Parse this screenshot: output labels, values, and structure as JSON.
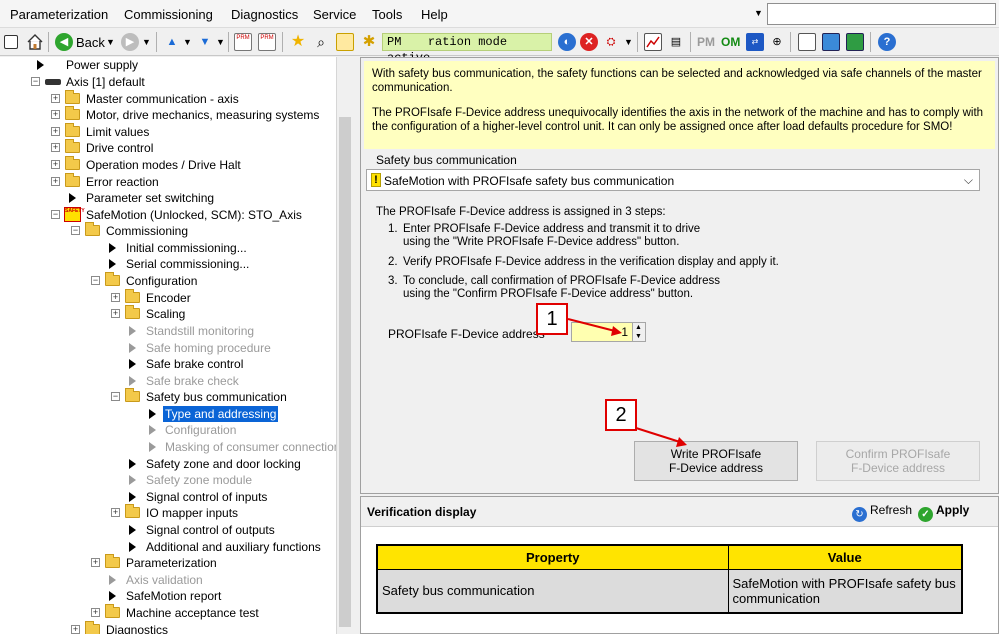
{
  "menubar": {
    "items": [
      "Parameterization",
      "Commissioning",
      "Diagnostics",
      "Service",
      "Tools",
      "Help"
    ],
    "search_value": ""
  },
  "toolbar": {
    "back_label": "Back",
    "mode_prefix": "PM",
    "mode_text": "ration mode active",
    "pm_label": "PM",
    "om_label": "OM"
  },
  "tree": {
    "nodes": [
      {
        "label": "Power supply"
      },
      {
        "label": "Axis [1] default"
      },
      {
        "label": "Master communication - axis"
      },
      {
        "label": "Motor, drive mechanics, measuring systems"
      },
      {
        "label": "Limit values"
      },
      {
        "label": "Drive control"
      },
      {
        "label": "Operation modes / Drive Halt"
      },
      {
        "label": "Error reaction"
      },
      {
        "label": "Parameter set switching"
      },
      {
        "label": "SafeMotion (Unlocked, SCM): STO_Axis",
        "badge": "SAFETY"
      },
      {
        "label": "Commissioning"
      },
      {
        "label": "Initial commissioning..."
      },
      {
        "label": "Serial commissioning..."
      },
      {
        "label": "Configuration"
      },
      {
        "label": "Encoder"
      },
      {
        "label": "Scaling"
      },
      {
        "label": "Standstill monitoring"
      },
      {
        "label": "Safe homing procedure"
      },
      {
        "label": "Safe brake control"
      },
      {
        "label": "Safe brake check"
      },
      {
        "label": "Safety bus communication"
      },
      {
        "label": "Type and addressing"
      },
      {
        "label": "Configuration"
      },
      {
        "label": "Masking of consumer connection"
      },
      {
        "label": "Safety zone and door locking"
      },
      {
        "label": "Safety zone module"
      },
      {
        "label": "Signal control of inputs"
      },
      {
        "label": "IO mapper inputs"
      },
      {
        "label": "Signal control of outputs"
      },
      {
        "label": "Additional and auxiliary functions"
      },
      {
        "label": "Parameterization"
      },
      {
        "label": "Axis validation"
      },
      {
        "label": "SafeMotion report"
      },
      {
        "label": "Machine acceptance test"
      },
      {
        "label": "Diagnostics"
      }
    ]
  },
  "info": {
    "paragraph1": "With safety bus communication, the safety functions can be selected and acknowledged via safe channels of the master communication.",
    "paragraph2": "The PROFIsafe F-Device address unequivocally identifies the axis in the network of the machine and has to comply with the configuration of a higher-level control unit. It can only be assigned once after load defaults procedure for SMO!"
  },
  "safety_bus": {
    "label": "Safety bus communication",
    "selected": "SafeMotion with PROFIsafe safety bus communication"
  },
  "steps": {
    "intro": "The PROFIsafe F-Device address is assigned in 3 steps:",
    "items": [
      {
        "num": "1.",
        "line1": "Enter PROFIsafe F-Device address and transmit it to drive",
        "line2": "using the \"Write PROFIsafe F-Device address\" button."
      },
      {
        "num": "2.",
        "line1": "Verify PROFIsafe F-Device address in the verification display and apply it.",
        "line2": ""
      },
      {
        "num": "3.",
        "line1": "To conclude, call confirmation of PROFIsafe F-Device address",
        "line2": "using the \"Confirm PROFIsafe F-Device address\" button."
      }
    ]
  },
  "address": {
    "label": "PROFIsafe F-Device address",
    "value": "1"
  },
  "buttons": {
    "write_line1": "Write PROFIsafe",
    "write_line2": "F-Device address",
    "confirm_line1": "Confirm PROFIsafe",
    "confirm_line2": "F-Device address"
  },
  "callouts": {
    "one": "1",
    "two": "2"
  },
  "verification": {
    "title": "Verification display",
    "refresh_label": "Refresh",
    "apply_label": "Apply",
    "columns": [
      "Property",
      "Value"
    ],
    "rows": [
      {
        "property": "Safety bus communication",
        "value": "SafeMotion with PROFIsafe safety bus communication"
      }
    ]
  },
  "colors": {
    "accent": "#0a64d6",
    "info_background": "#ffffc0",
    "table_header": "#ffe400",
    "callout_red": "#e00000",
    "mode_badge": "#d9f2a8"
  }
}
